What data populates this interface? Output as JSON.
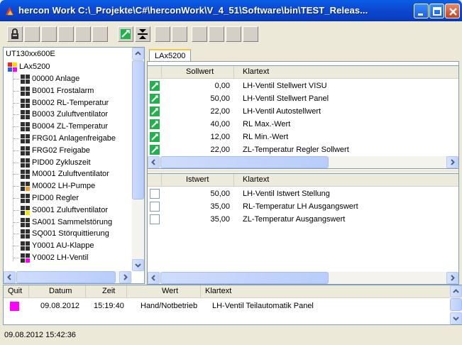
{
  "window": {
    "title": "hercon Work   C:\\_Projekte\\C#\\herconWork\\V_4_51\\Software\\bin\\TEST_Releas...",
    "accent": "#0a4ad4"
  },
  "toolbar": {
    "buttons": [
      "lock-icon",
      "blank",
      "blank",
      "blank",
      "blank",
      "valve-green-icon",
      "split-arrows-icon",
      "blank",
      "blank",
      "blank",
      "blank",
      "blank"
    ]
  },
  "tree": {
    "device": "UT130xx600E",
    "root": "LAx5200",
    "items": [
      {
        "label": "00000 Anlage",
        "icon": "module-dark"
      },
      {
        "label": "B0001 Frostalarm",
        "icon": "module-dark"
      },
      {
        "label": "B0002 RL-Temperatur",
        "icon": "module-dark"
      },
      {
        "label": "B0003 Zuluftventilator",
        "icon": "module-dark"
      },
      {
        "label": "B0004 ZL-Temperatur",
        "icon": "module-dark"
      },
      {
        "label": "FRG01 Anlagenfreigabe",
        "icon": "module-dark"
      },
      {
        "label": "FRG02 Freigabe",
        "icon": "module-dark"
      },
      {
        "label": "PID00 Zykluszeit",
        "icon": "module-dark"
      },
      {
        "label": "M0001 Zuluftventilator",
        "icon": "module-dark"
      },
      {
        "label": "M0002 LH-Pumpe",
        "icon": "module-orange"
      },
      {
        "label": "PID00 Regler",
        "icon": "module-dark"
      },
      {
        "label": "S0001 Zuluftventilator",
        "icon": "module-yellow"
      },
      {
        "label": "SA001 Sammelstörung",
        "icon": "module-dark"
      },
      {
        "label": "SQ001 Störquittierung",
        "icon": "module-dark"
      },
      {
        "label": "Y0001 AU-Klappe",
        "icon": "module-dark"
      },
      {
        "label": "Y0002 LH-Ventil",
        "icon": "module-magenta"
      }
    ]
  },
  "tab": "LAx5200",
  "setpoints": {
    "headers": [
      "",
      "Sollwert",
      "Klartext"
    ],
    "rows": [
      {
        "value": "0,00",
        "text": "LH-Ventil Stellwert VISU"
      },
      {
        "value": "50,00",
        "text": "LH-Ventil Stellwert Panel"
      },
      {
        "value": "22,00",
        "text": "LH-Ventil Autostellwert"
      },
      {
        "value": "40,00",
        "text": "RL Max.-Wert"
      },
      {
        "value": "12,00",
        "text": "RL Min.-Wert"
      },
      {
        "value": "22,00",
        "text": "ZL-Temperatur Regler Sollwert"
      }
    ]
  },
  "actuals": {
    "headers": [
      "",
      "Istwert",
      "Klartext"
    ],
    "rows": [
      {
        "value": "50,00",
        "text": "LH-Ventil Istwert Stellung"
      },
      {
        "value": "35,00",
        "text": "RL-Temperatur LH Ausgangswert"
      },
      {
        "value": "35,00",
        "text": "ZL-Temperatur Ausgangswert"
      }
    ]
  },
  "log": {
    "headers": [
      "Quit",
      "Datum",
      "Zeit",
      "Wert",
      "Klartext"
    ],
    "rows": [
      {
        "quit_color": "#ff00ff",
        "date": "09.08.2012",
        "time": "15:19:40",
        "value": "Hand/Notbetrieb",
        "text": "LH-Ventil Teilautomatik Panel"
      }
    ]
  },
  "status": "09.08.2012 15:42:36"
}
